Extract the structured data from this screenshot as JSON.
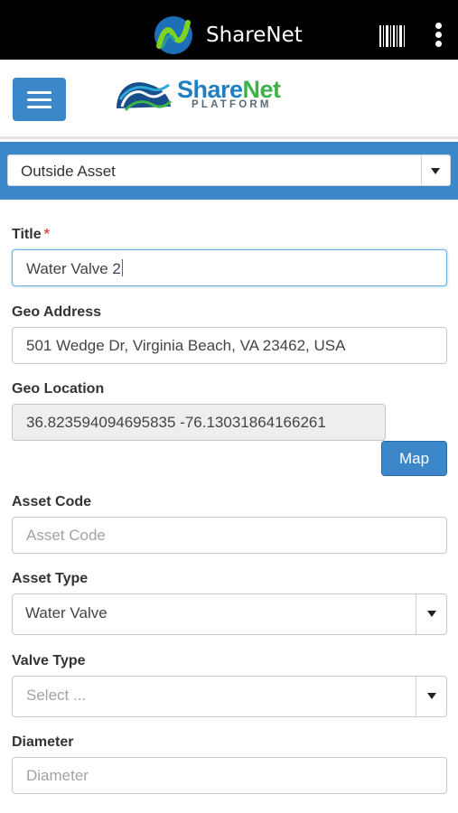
{
  "appbar": {
    "title": "ShareNet",
    "logo_icon": "sharenet-app-logo-icon",
    "barcode_icon": "barcode-icon",
    "menu_icon": "more-vert-icon"
  },
  "header": {
    "menu_icon": "hamburger-menu-icon",
    "brand_share": "Share",
    "brand_net": "Net",
    "brand_platform": "PLATFORM"
  },
  "category_select": {
    "value": "Outside Asset"
  },
  "form": {
    "title_label": "Title",
    "title_required": "*",
    "title_value": "Water Valve 2",
    "geo_address_label": "Geo Address",
    "geo_address_value": "501 Wedge Dr, Virginia Beach, VA 23462, USA",
    "geo_location_label": "Geo Location",
    "geo_location_value": "36.823594094695835 -76.13031864166261",
    "map_button": "Map",
    "asset_code_label": "Asset Code",
    "asset_code_placeholder": "Asset Code",
    "asset_type_label": "Asset Type",
    "asset_type_value": "Water Valve",
    "valve_type_label": "Valve Type",
    "valve_type_placeholder": "Select ...",
    "diameter_label": "Diameter",
    "diameter_placeholder": "Diameter"
  },
  "colors": {
    "appbar_bg": "#000000",
    "accent_blue": "#3b87c9",
    "brand_green": "#3cb44a",
    "required_red": "#d9534f"
  }
}
